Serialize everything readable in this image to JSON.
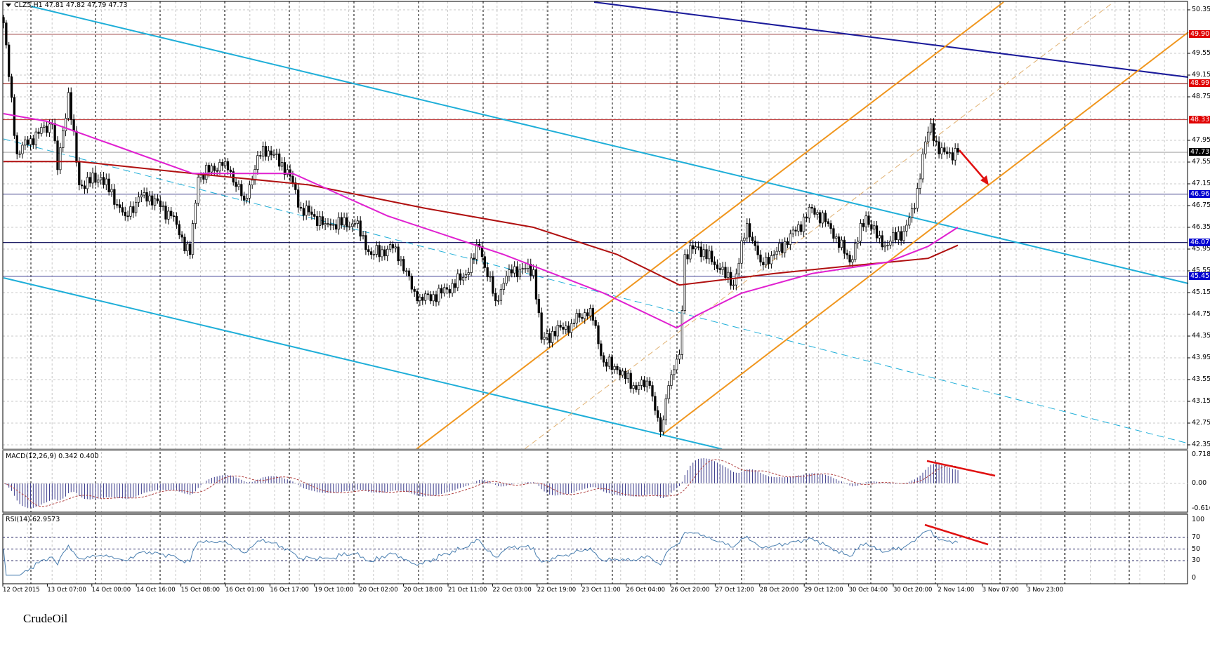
{
  "header": {
    "symbol_line": "CLZ5,H1  47.81 47.82 47.79 47.73",
    "macd_label": "MACD(12,26,9) 0.342 0.400",
    "rsi_label": "RSI(14) 62.9573"
  },
  "caption": "CrudeOil",
  "chart_data": {
    "type": "candlestick",
    "title": "CLZ5,H1",
    "price_axis_ticks": [
      "50.35",
      "49.55",
      "49.15",
      "48.75",
      "47.95",
      "47.55",
      "47.15",
      "46.75",
      "46.35",
      "45.95",
      "45.55",
      "45.15",
      "44.75",
      "44.35",
      "43.95",
      "43.55",
      "43.15",
      "42.75",
      "42.35"
    ],
    "ylim": [
      42.35,
      50.35
    ],
    "time_labels": [
      "12 Oct 2015",
      "13 Oct 07:00",
      "14 Oct 00:00",
      "14 Oct 16:00",
      "15 Oct 08:00",
      "16 Oct 01:00",
      "16 Oct 17:00",
      "19 Oct 10:00",
      "20 Oct 02:00",
      "20 Oct 18:00",
      "21 Oct 11:00",
      "22 Oct 03:00",
      "22 Oct 19:00",
      "23 Oct 11:00",
      "26 Oct 04:00",
      "26 Oct 20:00",
      "27 Oct 12:00",
      "28 Oct 20:00",
      "29 Oct 12:00",
      "30 Oct 04:00",
      "30 Oct 20:00",
      "2 Nov 14:00",
      "3 Nov 07:00",
      "3 Nov 23:00"
    ],
    "close_path": [
      [
        0,
        50.11
      ],
      [
        2,
        49.12
      ],
      [
        5,
        47.7
      ],
      [
        10,
        47.98
      ],
      [
        18,
        48.26
      ],
      [
        20,
        47.41
      ],
      [
        24,
        48.83
      ],
      [
        28,
        47.13
      ],
      [
        36,
        47.27
      ],
      [
        45,
        46.56
      ],
      [
        52,
        46.99
      ],
      [
        62,
        46.56
      ],
      [
        69,
        45.85
      ],
      [
        72,
        47.27
      ],
      [
        82,
        47.56
      ],
      [
        89,
        46.85
      ],
      [
        96,
        47.84
      ],
      [
        105,
        47.41
      ],
      [
        110,
        46.7
      ],
      [
        119,
        46.42
      ],
      [
        130,
        46.42
      ],
      [
        136,
        45.85
      ],
      [
        145,
        45.99
      ],
      [
        153,
        45.0
      ],
      [
        162,
        45.14
      ],
      [
        170,
        45.43
      ],
      [
        176,
        45.99
      ],
      [
        182,
        45.0
      ],
      [
        187,
        45.57
      ],
      [
        196,
        45.57
      ],
      [
        199,
        44.29
      ],
      [
        210,
        44.58
      ],
      [
        217,
        44.86
      ],
      [
        222,
        43.87
      ],
      [
        227,
        43.73
      ],
      [
        233,
        43.44
      ],
      [
        239,
        43.44
      ],
      [
        243,
        42.59
      ],
      [
        246,
        43.44
      ],
      [
        250,
        44.01
      ],
      [
        252,
        45.85
      ],
      [
        257,
        45.99
      ],
      [
        265,
        45.57
      ],
      [
        270,
        45.29
      ],
      [
        275,
        46.42
      ],
      [
        280,
        45.71
      ],
      [
        285,
        45.85
      ],
      [
        293,
        46.28
      ],
      [
        299,
        46.7
      ],
      [
        305,
        46.42
      ],
      [
        313,
        45.71
      ],
      [
        319,
        46.56
      ],
      [
        325,
        45.99
      ],
      [
        333,
        46.28
      ],
      [
        337,
        46.7
      ],
      [
        340,
        47.7
      ],
      [
        343,
        48.26
      ],
      [
        346,
        47.7
      ],
      [
        353,
        47.73
      ]
    ],
    "ma_fast": [
      [
        0,
        48.44
      ],
      [
        16,
        48.3
      ],
      [
        42,
        47.84
      ],
      [
        70,
        47.34
      ],
      [
        107,
        47.34
      ],
      [
        142,
        46.56
      ],
      [
        185,
        45.85
      ],
      [
        222,
        45.14
      ],
      [
        249,
        44.5
      ],
      [
        256,
        44.72
      ],
      [
        273,
        45.14
      ],
      [
        299,
        45.5
      ],
      [
        327,
        45.71
      ],
      [
        342,
        46.0
      ],
      [
        353,
        46.35
      ]
    ],
    "ma_slow": [
      [
        0,
        47.56
      ],
      [
        28,
        47.56
      ],
      [
        70,
        47.34
      ],
      [
        113,
        47.13
      ],
      [
        156,
        46.7
      ],
      [
        196,
        46.35
      ],
      [
        227,
        45.85
      ],
      [
        250,
        45.29
      ],
      [
        285,
        45.5
      ],
      [
        313,
        45.64
      ],
      [
        342,
        45.78
      ],
      [
        353,
        46.02
      ]
    ],
    "levels": [
      {
        "value": "49.90",
        "color": "#b06a6a",
        "tag": "#e00000"
      },
      {
        "value": "48.99",
        "color": "#a0302a",
        "tag": "#e00000"
      },
      {
        "value": "48.33",
        "color": "#c04040",
        "tag": "#e00000"
      },
      {
        "value": "47.73",
        "color": "#a8a8a8",
        "tag": "#000000"
      },
      {
        "value": "46.96",
        "color": "#7070a8",
        "tag": "#0000d0"
      },
      {
        "value": "46.07",
        "color": "#000050",
        "tag": "#0000d0"
      },
      {
        "value": "45.45",
        "color": "#6666aa",
        "tag": "#0000d0"
      }
    ],
    "macd_axis": [
      "0.718",
      "0.00",
      "-0.616"
    ],
    "macd_range": [
      -0.616,
      0.718
    ],
    "rsi_axis": [
      "100",
      "70",
      "50",
      "30",
      "0"
    ],
    "colors": {
      "ma_fast": "#e020d0",
      "ma_slow": "#b01010",
      "channel_down": "#1eaed8",
      "channel_up": "#f0961e",
      "trend": "#1a1a9a",
      "arrow": "#e01010"
    }
  }
}
